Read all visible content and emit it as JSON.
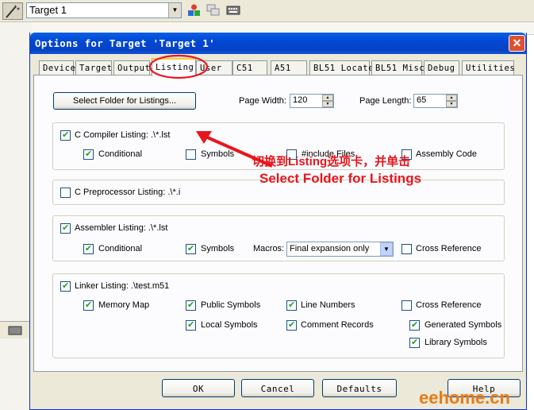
{
  "ide": {
    "target_name": "Target 1",
    "toolbar_icons": [
      "shapes-icon",
      "stack-windows-icon",
      "keyboard-icon"
    ]
  },
  "dialog": {
    "title": "Options for Target 'Target 1'",
    "close_glyph": "✕",
    "tabs": [
      "Device",
      "Target",
      "Output",
      "Listing",
      "User",
      "C51",
      "A51",
      "BL51 Locate",
      "BL51 Misc",
      "Debug",
      "Utilities"
    ],
    "active_tab": "Listing"
  },
  "listing": {
    "select_folder_label": "Select Folder for Listings...",
    "page_width_label": "Page Width:",
    "page_width_value": "120",
    "page_length_label": "Page Length:",
    "page_length_value": "65",
    "c_compiler": {
      "label": "C Compiler Listing:  .\\*.lst",
      "checked": true,
      "conditional": "Conditional",
      "symbols": "Symbols",
      "include_files": "#include Files",
      "assembly_code": "Assembly Code"
    },
    "c_preprocessor": {
      "label": "C Preprocessor Listing:  .\\*.i",
      "checked": false
    },
    "assembler": {
      "label": "Assembler Listing:  .\\*.lst",
      "checked": true,
      "conditional": "Conditional",
      "symbols": "Symbols",
      "macros_label": "Macros:",
      "macros_value": "Final expansion only",
      "cross_reference": "Cross Reference"
    },
    "linker": {
      "label": "Linker Listing:  .\\test.m51",
      "checked": true,
      "memory_map": "Memory Map",
      "public_symbols": "Public Symbols",
      "line_numbers": "Line Numbers",
      "cross_reference": "Cross Reference",
      "local_symbols": "Local Symbols",
      "comment_records": "Comment Records",
      "generated_symbols": "Generated Symbols",
      "library_symbols": "Library Symbols"
    }
  },
  "buttons": {
    "ok": "OK",
    "cancel": "Cancel",
    "defaults": "Defaults",
    "help": "Help"
  },
  "annotation": {
    "line1": "切换到Listing选项卡，并单击",
    "line2": "Select  Folder for Listings",
    "color": "#e8161c"
  },
  "watermark": "eehome.cn"
}
